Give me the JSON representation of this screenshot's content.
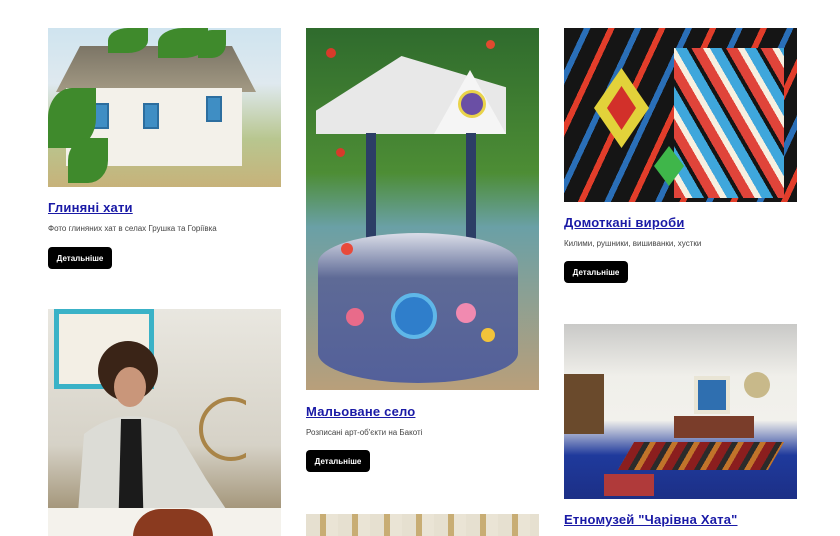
{
  "cards": [
    {
      "id": "clay-houses",
      "title": "Глиняні хати",
      "subtitle": "Фото глиняних хат в селах Грушка та Горіївка",
      "button": "Детальніше"
    },
    {
      "id": "painted-village",
      "title": "Мальоване село",
      "subtitle": "Розписані арт-об'єкти на Бакоті",
      "button": "Детальніше"
    },
    {
      "id": "homespun",
      "title": "Домоткані вироби",
      "subtitle": "Килими, рушники, вишиванки, хустки",
      "button": "Детальніше"
    },
    {
      "id": "ethnomuseum",
      "title": "Етномузей \"Чарівна Хата\""
    }
  ],
  "colors": {
    "link": "#1a1aa6",
    "button_bg": "#000000",
    "button_text": "#ffffff"
  }
}
